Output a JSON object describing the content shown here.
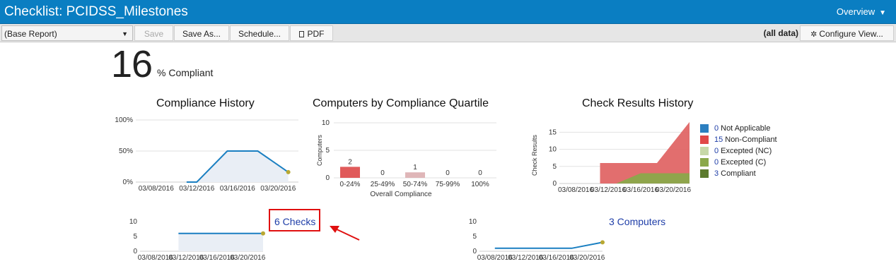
{
  "header": {
    "title": "Checklist: PCIDSS_Milestones",
    "overview_label": "Overview"
  },
  "toolbar": {
    "report_select": "(Base Report)",
    "save": "Save",
    "save_as": "Save As...",
    "schedule": "Schedule...",
    "pdf": "PDF",
    "all_data": "(all data)",
    "configure_view": "Configure View..."
  },
  "summary": {
    "percent": "16",
    "percent_label": "% Compliant"
  },
  "colors": {
    "accent": "#0a7ec2",
    "line": "#1a7fc1",
    "point": "#b8a832",
    "bar": "#e05a5a",
    "bar_light": "#dfb6b8",
    "noncompliant": "#e06666",
    "compliant": "#8aa84a",
    "highlight": "#e01010"
  },
  "chart_data": [
    {
      "type": "area",
      "title": "Compliance History",
      "x": [
        "03/08/2016",
        "03/11/2016",
        "03/12/2016",
        "03/15/2016",
        "03/18/2016",
        "03/21/2016"
      ],
      "xticks": [
        "03/08/2016",
        "03/12/2016",
        "03/16/2016",
        "03/20/2016"
      ],
      "yticks": [
        "0%",
        "50%",
        "100%"
      ],
      "values": [
        null,
        0,
        0,
        50,
        50,
        16
      ],
      "ylim": [
        0,
        100
      ]
    },
    {
      "type": "bar",
      "title": "Computers by Compliance Quartile",
      "categories": [
        "0-24%",
        "25-49%",
        "50-74%",
        "75-99%",
        "100%"
      ],
      "values": [
        2,
        0,
        1,
        0,
        0
      ],
      "xlabel": "Overall Compliance",
      "ylabel": "Computers",
      "yticks": [
        "0",
        "5",
        "10"
      ],
      "ylim": [
        0,
        10
      ]
    },
    {
      "type": "area",
      "title": "Check Results History",
      "ylabel": "Check Results",
      "xticks": [
        "03/08/2016",
        "03/12/2016",
        "03/16/2016",
        "03/20/2016"
      ],
      "yticks": [
        "0",
        "5",
        "10",
        "15"
      ],
      "ylim": [
        0,
        19
      ],
      "x": [
        "03/11/2016",
        "03/12/2016",
        "03/13/2016",
        "03/14/2016",
        "03/16/2016",
        "03/18/2016",
        "03/22/2016"
      ],
      "series": [
        {
          "name": "Non-Compliant",
          "count": "15",
          "values": [
            6,
            6,
            6,
            6,
            6,
            6,
            18
          ]
        },
        {
          "name": "Compliant",
          "count": "3",
          "values": [
            0,
            0,
            0,
            1,
            3,
            3,
            3
          ]
        }
      ],
      "legend": [
        {
          "name": "Not Applicable",
          "count": "0",
          "color": "#2c7fc0"
        },
        {
          "name": "Non-Compliant",
          "count": "15",
          "color": "#e04848"
        },
        {
          "name": "Excepted (NC)",
          "count": "0",
          "color": "#c7d8a8"
        },
        {
          "name": "Excepted (C)",
          "count": "0",
          "color": "#8aa84a"
        },
        {
          "name": "Compliant",
          "count": "3",
          "color": "#5c7a2e"
        }
      ],
      "legend_position": "right"
    },
    {
      "type": "area",
      "title": "",
      "xticks": [
        "03/08/2016",
        "03/12/2016",
        "03/16/2016",
        "03/20/2016"
      ],
      "yticks": [
        "0",
        "5",
        "10"
      ],
      "x": [
        "03/11/2016",
        "03/22/2016"
      ],
      "values": [
        6,
        6
      ],
      "ylim": [
        0,
        10
      ]
    },
    {
      "type": "line",
      "title": "",
      "xticks": [
        "03/08/2016",
        "03/12/2016",
        "03/16/2016",
        "03/20/2016"
      ],
      "yticks": [
        "0",
        "5",
        "10"
      ],
      "x": [
        "03/08/2016",
        "03/18/2016",
        "03/22/2016"
      ],
      "values": [
        1,
        1,
        3
      ],
      "ylim": [
        0,
        10
      ]
    }
  ],
  "links": {
    "checks": "6 Checks",
    "computers": "3 Computers"
  }
}
